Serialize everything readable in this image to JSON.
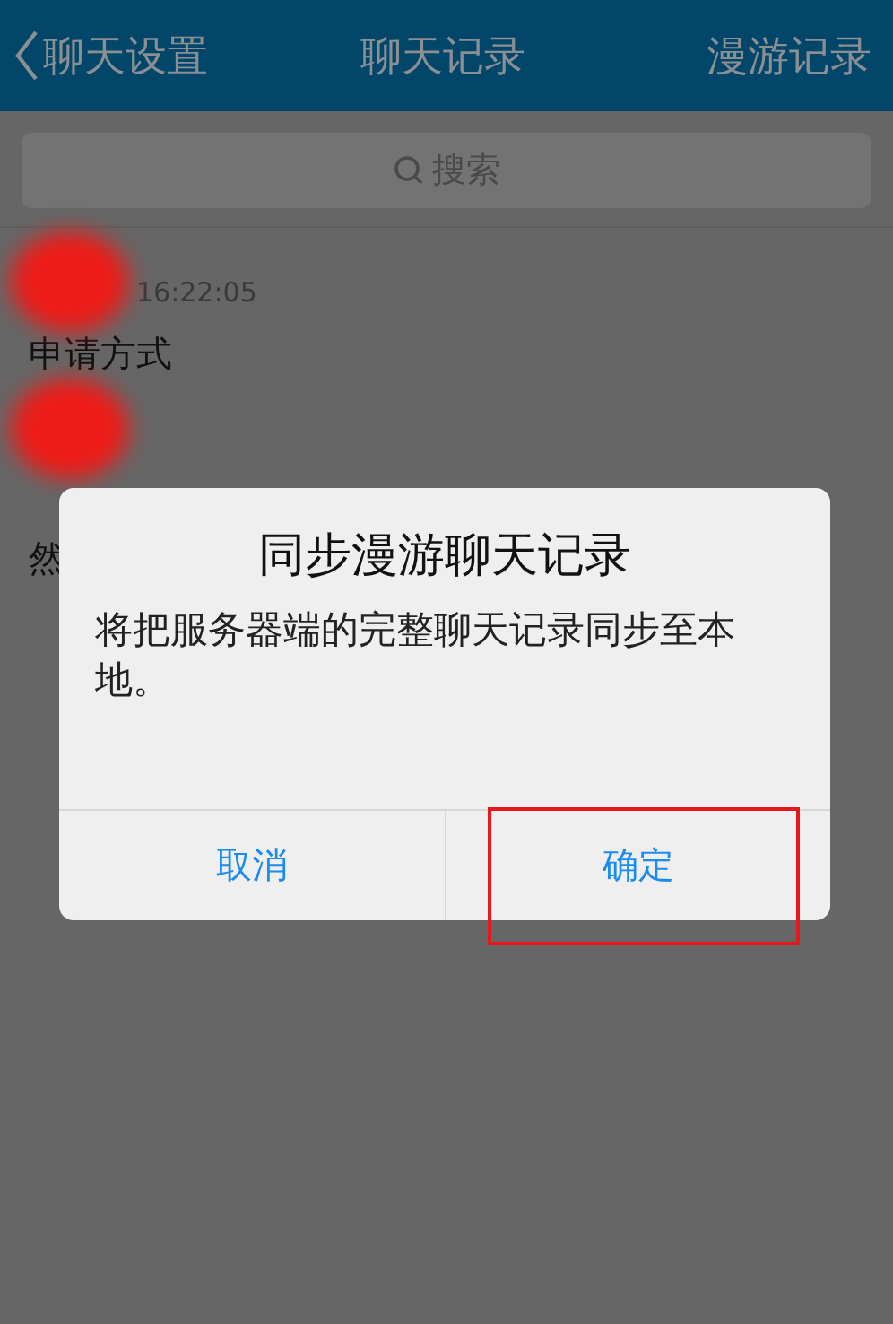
{
  "header": {
    "back_label": "聊天设置",
    "title": "聊天记录",
    "action": "漫游记录"
  },
  "search": {
    "placeholder": "搜索"
  },
  "messages": [
    {
      "time": "16:22:05",
      "text": "申请方式",
      "sender_redacted": true
    },
    {
      "text": "然",
      "sender_redacted": true
    }
  ],
  "dialog": {
    "title": "同步漫游聊天记录",
    "message": "将把服务器端的完整聊天记录同步至本地。",
    "buttons": [
      {
        "label": "取消",
        "highlighted": false
      },
      {
        "label": "确定",
        "highlighted": true
      }
    ]
  }
}
